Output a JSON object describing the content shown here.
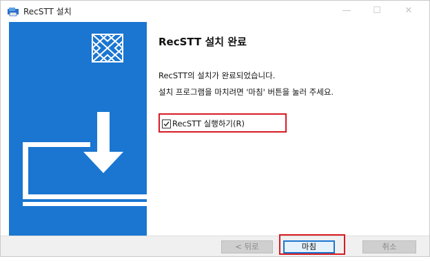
{
  "window": {
    "title": "RecSTT 설치",
    "minimize_icon": "minimize-icon",
    "maximize_icon": "maximize-icon",
    "close_icon": "close-icon"
  },
  "side_panel": {
    "color": "#1a76d1",
    "logo_icon": "diamond-grid-logo",
    "illustration_icon": "laptop-download-icon"
  },
  "content": {
    "heading": "RecSTT 설치 완료",
    "line1": "RecSTT의 설치가 완료되었습니다.",
    "line2": "설치 프로그램을 마치려면 '마침' 버튼을 눌러 주세요.",
    "checkbox_label": "RecSTT 실행하기(R)",
    "checkbox_checked": true
  },
  "footer": {
    "back_label": "< 뒤로",
    "finish_label": "마침",
    "cancel_label": "취소"
  },
  "highlight_color": "#d71920"
}
